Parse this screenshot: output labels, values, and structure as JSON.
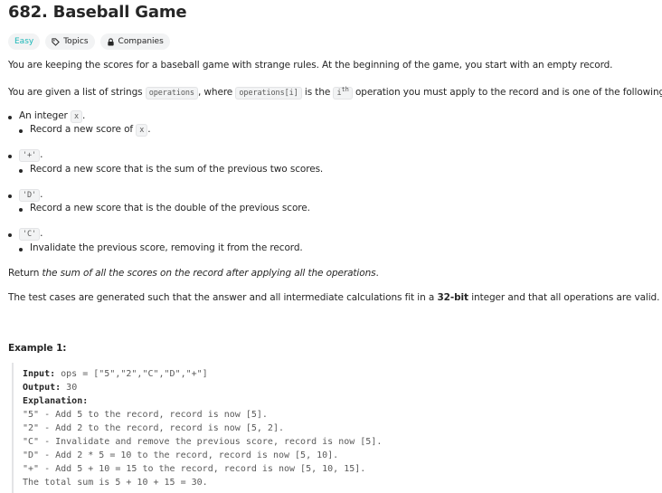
{
  "problem": {
    "title": "682. Baseball Game",
    "difficulty": "Easy",
    "topics_label": "Topics",
    "companies_label": "Companies"
  },
  "description": {
    "intro": "You are keeping the scores for a baseball game with strange rules. At the beginning of the game, you start with an empty record.",
    "line2_a": "You are given a list of strings ",
    "line2_code1": "operations",
    "line2_b": ", where ",
    "line2_code2": "operations[i]",
    "line2_c": " is the ",
    "line2_code3": "i",
    "line2_sup": "th",
    "line2_d": " operation you must apply to the record and is one of the following:",
    "ops": [
      {
        "head_text": "An integer ",
        "head_code": "x",
        "head_tail": ".",
        "sub_text": "Record a new score of ",
        "sub_code": "x",
        "sub_tail": "."
      },
      {
        "head_text": "",
        "head_code": "'+'",
        "head_tail": ".",
        "sub_text": "Record a new score that is the sum of the previous two scores.",
        "sub_code": "",
        "sub_tail": ""
      },
      {
        "head_text": "",
        "head_code": "'D'",
        "head_tail": ".",
        "sub_text": "Record a new score that is the double of the previous score.",
        "sub_code": "",
        "sub_tail": ""
      },
      {
        "head_text": "",
        "head_code": "'C'",
        "head_tail": ".",
        "sub_text": "Invalidate the previous score, removing it from the record.",
        "sub_code": "",
        "sub_tail": ""
      }
    ],
    "return_a": "Return ",
    "return_em": "the sum of all the scores on the record after applying all the operations",
    "return_b": ".",
    "test_a": "The test cases are generated such that the answer and all intermediate calculations fit in a ",
    "test_bold": "32-bit",
    "test_b": " integer and that all operations are valid."
  },
  "example": {
    "heading": "Example 1:",
    "input_label": "Input:",
    "input_value": " ops = [\"5\",\"2\",\"C\",\"D\",\"+\"]",
    "output_label": "Output:",
    "output_value": " 30",
    "explanation_label": "Explanation:",
    "lines": [
      "\"5\" - Add 5 to the record, record is now [5].",
      "\"2\" - Add 2 to the record, record is now [5, 2].",
      "\"C\" - Invalidate and remove the previous score, record is now [5].",
      "\"D\" - Add 2 * 5 = 10 to the record, record is now [5, 10].",
      "\"+\" - Add 5 + 10 = 15 to the record, record is now [5, 10, 15].",
      "The total sum is 5 + 10 + 15 = 30."
    ]
  }
}
